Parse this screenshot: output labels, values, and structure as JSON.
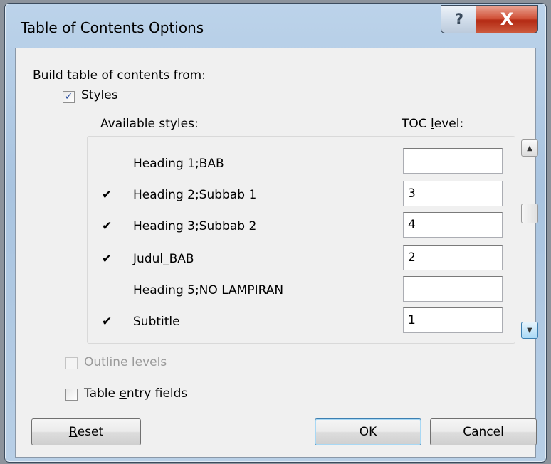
{
  "window": {
    "title": "Table of Contents Options",
    "help_glyph": "?",
    "close_glyph": "X"
  },
  "dialog": {
    "section_label": "Build table of contents from:",
    "styles": {
      "label_prefix": "",
      "label_u": "S",
      "label_rest": "tyles",
      "checked": true,
      "check_glyph": "✓"
    },
    "available_styles_label": "Available styles:",
    "toc_level": {
      "label_prefix": "TOC ",
      "label_u": "l",
      "label_rest": "evel:"
    },
    "rows": [
      {
        "check": "",
        "name": "Heading 1;BAB",
        "level": ""
      },
      {
        "check": "✔",
        "name": "Heading 2;Subbab 1",
        "level": "3"
      },
      {
        "check": "✔",
        "name": "Heading 3;Subbab 2",
        "level": "4"
      },
      {
        "check": "✔",
        "name": "Judul_BAB",
        "level": "2"
      },
      {
        "check": "",
        "name": "Heading 5;NO LAMPIRAN",
        "level": ""
      },
      {
        "check": "✔",
        "name": "Subtitle",
        "level": "1"
      }
    ],
    "scroll_up_glyph": "▲",
    "scroll_down_glyph": "▼",
    "outline_levels": {
      "label": "Outline levels",
      "checked": false,
      "enabled": false
    },
    "table_entry_fields": {
      "label_prefix": "Table ",
      "label_u": "e",
      "label_rest": "ntry fields",
      "checked": false
    }
  },
  "buttons": {
    "reset": {
      "label_u": "R",
      "label_rest": "eset"
    },
    "ok": "OK",
    "cancel": "Cancel"
  }
}
